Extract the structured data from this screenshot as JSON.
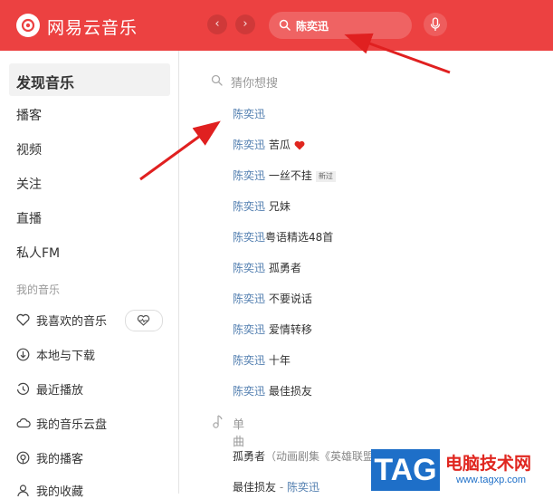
{
  "app": {
    "brand": "网易云音乐",
    "nav_back": "‹",
    "nav_forward": "›"
  },
  "search": {
    "value": "陈奕迅"
  },
  "sidebar": {
    "active": "发现音乐",
    "items": [
      "播客",
      "视频",
      "关注",
      "直播",
      "私人FM"
    ],
    "section_label": "我的音乐",
    "my_music": [
      {
        "label": "我喜欢的音乐",
        "icon": "heart-icon"
      },
      {
        "label": "本地与下载",
        "icon": "download-icon"
      },
      {
        "label": "最近播放",
        "icon": "history-icon"
      },
      {
        "label": "我的音乐云盘",
        "icon": "cloud-icon"
      },
      {
        "label": "我的播客",
        "icon": "podcast-icon"
      },
      {
        "label": "我的收藏",
        "icon": "user-icon"
      }
    ]
  },
  "dropdown": {
    "guess_label": "猜你想搜",
    "suggestions": [
      {
        "hl": "陈奕迅",
        "rest": ""
      },
      {
        "hl": "陈奕迅",
        "rest": " 苦瓜",
        "heart": true
      },
      {
        "hl": "陈奕迅",
        "rest": " 一丝不挂",
        "badge": "新过"
      },
      {
        "hl": "陈奕迅",
        "rest": " 兄妹"
      },
      {
        "hl": "陈奕迅",
        "rest": "粤语精选48首"
      },
      {
        "hl": "陈奕迅",
        "rest": " 孤勇者"
      },
      {
        "hl": "陈奕迅",
        "rest": " 不要说话"
      },
      {
        "hl": "陈奕迅",
        "rest": " 爱情转移"
      },
      {
        "hl": "陈奕迅",
        "rest": " 十年"
      },
      {
        "hl": "陈奕迅",
        "rest": " 最佳损友"
      }
    ],
    "songs_label": "单曲",
    "songs": [
      {
        "title": "孤勇者",
        "extra": "（动画剧集《英雄联盟",
        "artist": ""
      },
      {
        "title": "最佳损友",
        "extra": " - ",
        "artist": "陈奕迅"
      }
    ]
  },
  "colors": {
    "brand_red": "#ec4141",
    "highlight_blue": "#507daf",
    "arrow_red": "#e02020"
  },
  "watermark": {
    "tag": "TAG",
    "title": "电脑技术网",
    "url": "www.tagxp.com"
  }
}
